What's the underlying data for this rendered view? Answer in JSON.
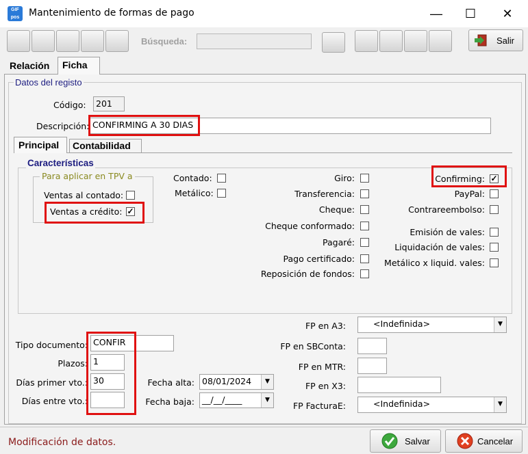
{
  "window": {
    "title": "Mantenimiento de formas de pago",
    "app_icon_text": "GIF pos",
    "minimize": "—",
    "maximize": "☐",
    "close": "✕"
  },
  "toolbar": {
    "search_label": "Búsqueda:",
    "search_value": "",
    "exit_label": "Salir"
  },
  "tabs": {
    "relacion": "Relación",
    "ficha": "Ficha"
  },
  "record": {
    "group_title": "Datos del registo",
    "codigo_label": "Código:",
    "codigo_value": "201",
    "descripcion_label": "Descripción:",
    "descripcion_value": "CONFIRMING A 30 DIAS"
  },
  "sub_tabs": {
    "principal": "Principal",
    "contabilidad": "Contabilidad"
  },
  "caracteristicas": {
    "title": "Características",
    "tpv_group": "Para aplicar en TPV a",
    "ventas_contado": "Ventas al contado:",
    "ventas_credito": "Ventas a crédito:",
    "contado": "Contado:",
    "metalico": "Metálico:",
    "giro": "Giro:",
    "transferencia": "Transferencia:",
    "cheque": "Cheque:",
    "cheque_conformado": "Cheque conformado:",
    "pagare": "Pagaré:",
    "pago_certificado": "Pago certificado:",
    "reposicion_fondos": "Reposición de fondos:",
    "confirming": "Confirming:",
    "paypal": "PayPal:",
    "contrareembolso": "Contrareembolso:",
    "emision_vales": "Emisión de vales:",
    "liquidacion_vales": "Liquidación de vales:",
    "metalico_liquid_vales": "Metálico x liquid. vales:",
    "check_mark": "✓"
  },
  "bottom": {
    "tipo_documento_label": "Tipo documento:",
    "tipo_documento_value": "CONFIR",
    "plazos_label": "Plazos:",
    "plazos_value": "1",
    "dias_primer_label": "Días primer vto.:",
    "dias_primer_value": "30",
    "dias_entre_label": "Días entre vto.:",
    "dias_entre_value": "",
    "fecha_alta_label": "Fecha alta:",
    "fecha_alta_value": "08/01/2024",
    "fecha_baja_label": "Fecha baja:",
    "fecha_baja_value": "__/__/____",
    "fp_a3_label": "FP en A3:",
    "fp_a3_value": "<Indefinida>",
    "fp_sbconta_label": "FP en SBConta:",
    "fp_mtr_label": "FP en MTR:",
    "fp_x3_label": "FP en X3:",
    "fp_facturae_label": "FP FacturaE:",
    "fp_facturae_value": "<Indefinida>"
  },
  "status": {
    "message": "Modificación de datos.",
    "save_label": "Salvar",
    "cancel_label": "Cancelar"
  },
  "colors": {
    "highlight": "#e01010",
    "status_text": "#8a1a1a",
    "legend": "#1c1c80",
    "tpv_legend": "#8a8a20"
  }
}
